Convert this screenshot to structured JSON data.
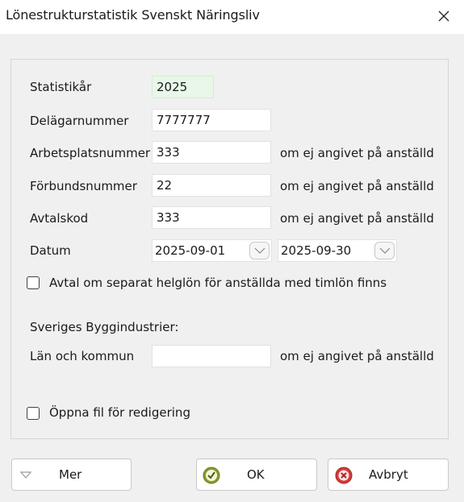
{
  "window": {
    "title": "Lönestrukturstatistik Svenskt Näringsliv"
  },
  "form": {
    "statistikar": {
      "label": "Statistikår",
      "value": "2025"
    },
    "delagarnummer": {
      "label": "Delägarnummer",
      "value": "7777777"
    },
    "arbetsplatsnummer": {
      "label": "Arbetsplatsnummer",
      "value": "333",
      "note": "om ej angivet på anställd"
    },
    "forbundsnummer": {
      "label": "Förbundsnummer",
      "value": "22",
      "note": "om ej angivet på anställd"
    },
    "avtalskod": {
      "label": "Avtalskod",
      "value": "333",
      "note": "om ej angivet på anställd"
    },
    "datum": {
      "label": "Datum",
      "from": "2025-09-01",
      "to": "2025-09-30"
    },
    "helglon": {
      "label": "Avtal om separat helglön för anställda med timlön finns",
      "checked": false
    },
    "sveriges_byggindustrier": {
      "heading": "Sveriges Byggindustrier:"
    },
    "lan_kommun": {
      "label": "Län och kommun",
      "value": "",
      "note": "om ej angivet på anställd"
    },
    "oppna_fil": {
      "label": "Öppna fil för redigering",
      "checked": false
    }
  },
  "buttons": {
    "mer": "Mer",
    "ok": "OK",
    "avbryt": "Avbryt"
  },
  "icons": {
    "close": "close-icon",
    "dropdown": "chevron-down-icon",
    "ok": "check-circle-icon",
    "cancel": "cancel-circle-icon",
    "more": "triangle-down-icon"
  },
  "colors": {
    "readonly_field": "#e8f7e8",
    "ok_icon": "#8a9a2a",
    "cancel_icon": "#d33a3a"
  }
}
